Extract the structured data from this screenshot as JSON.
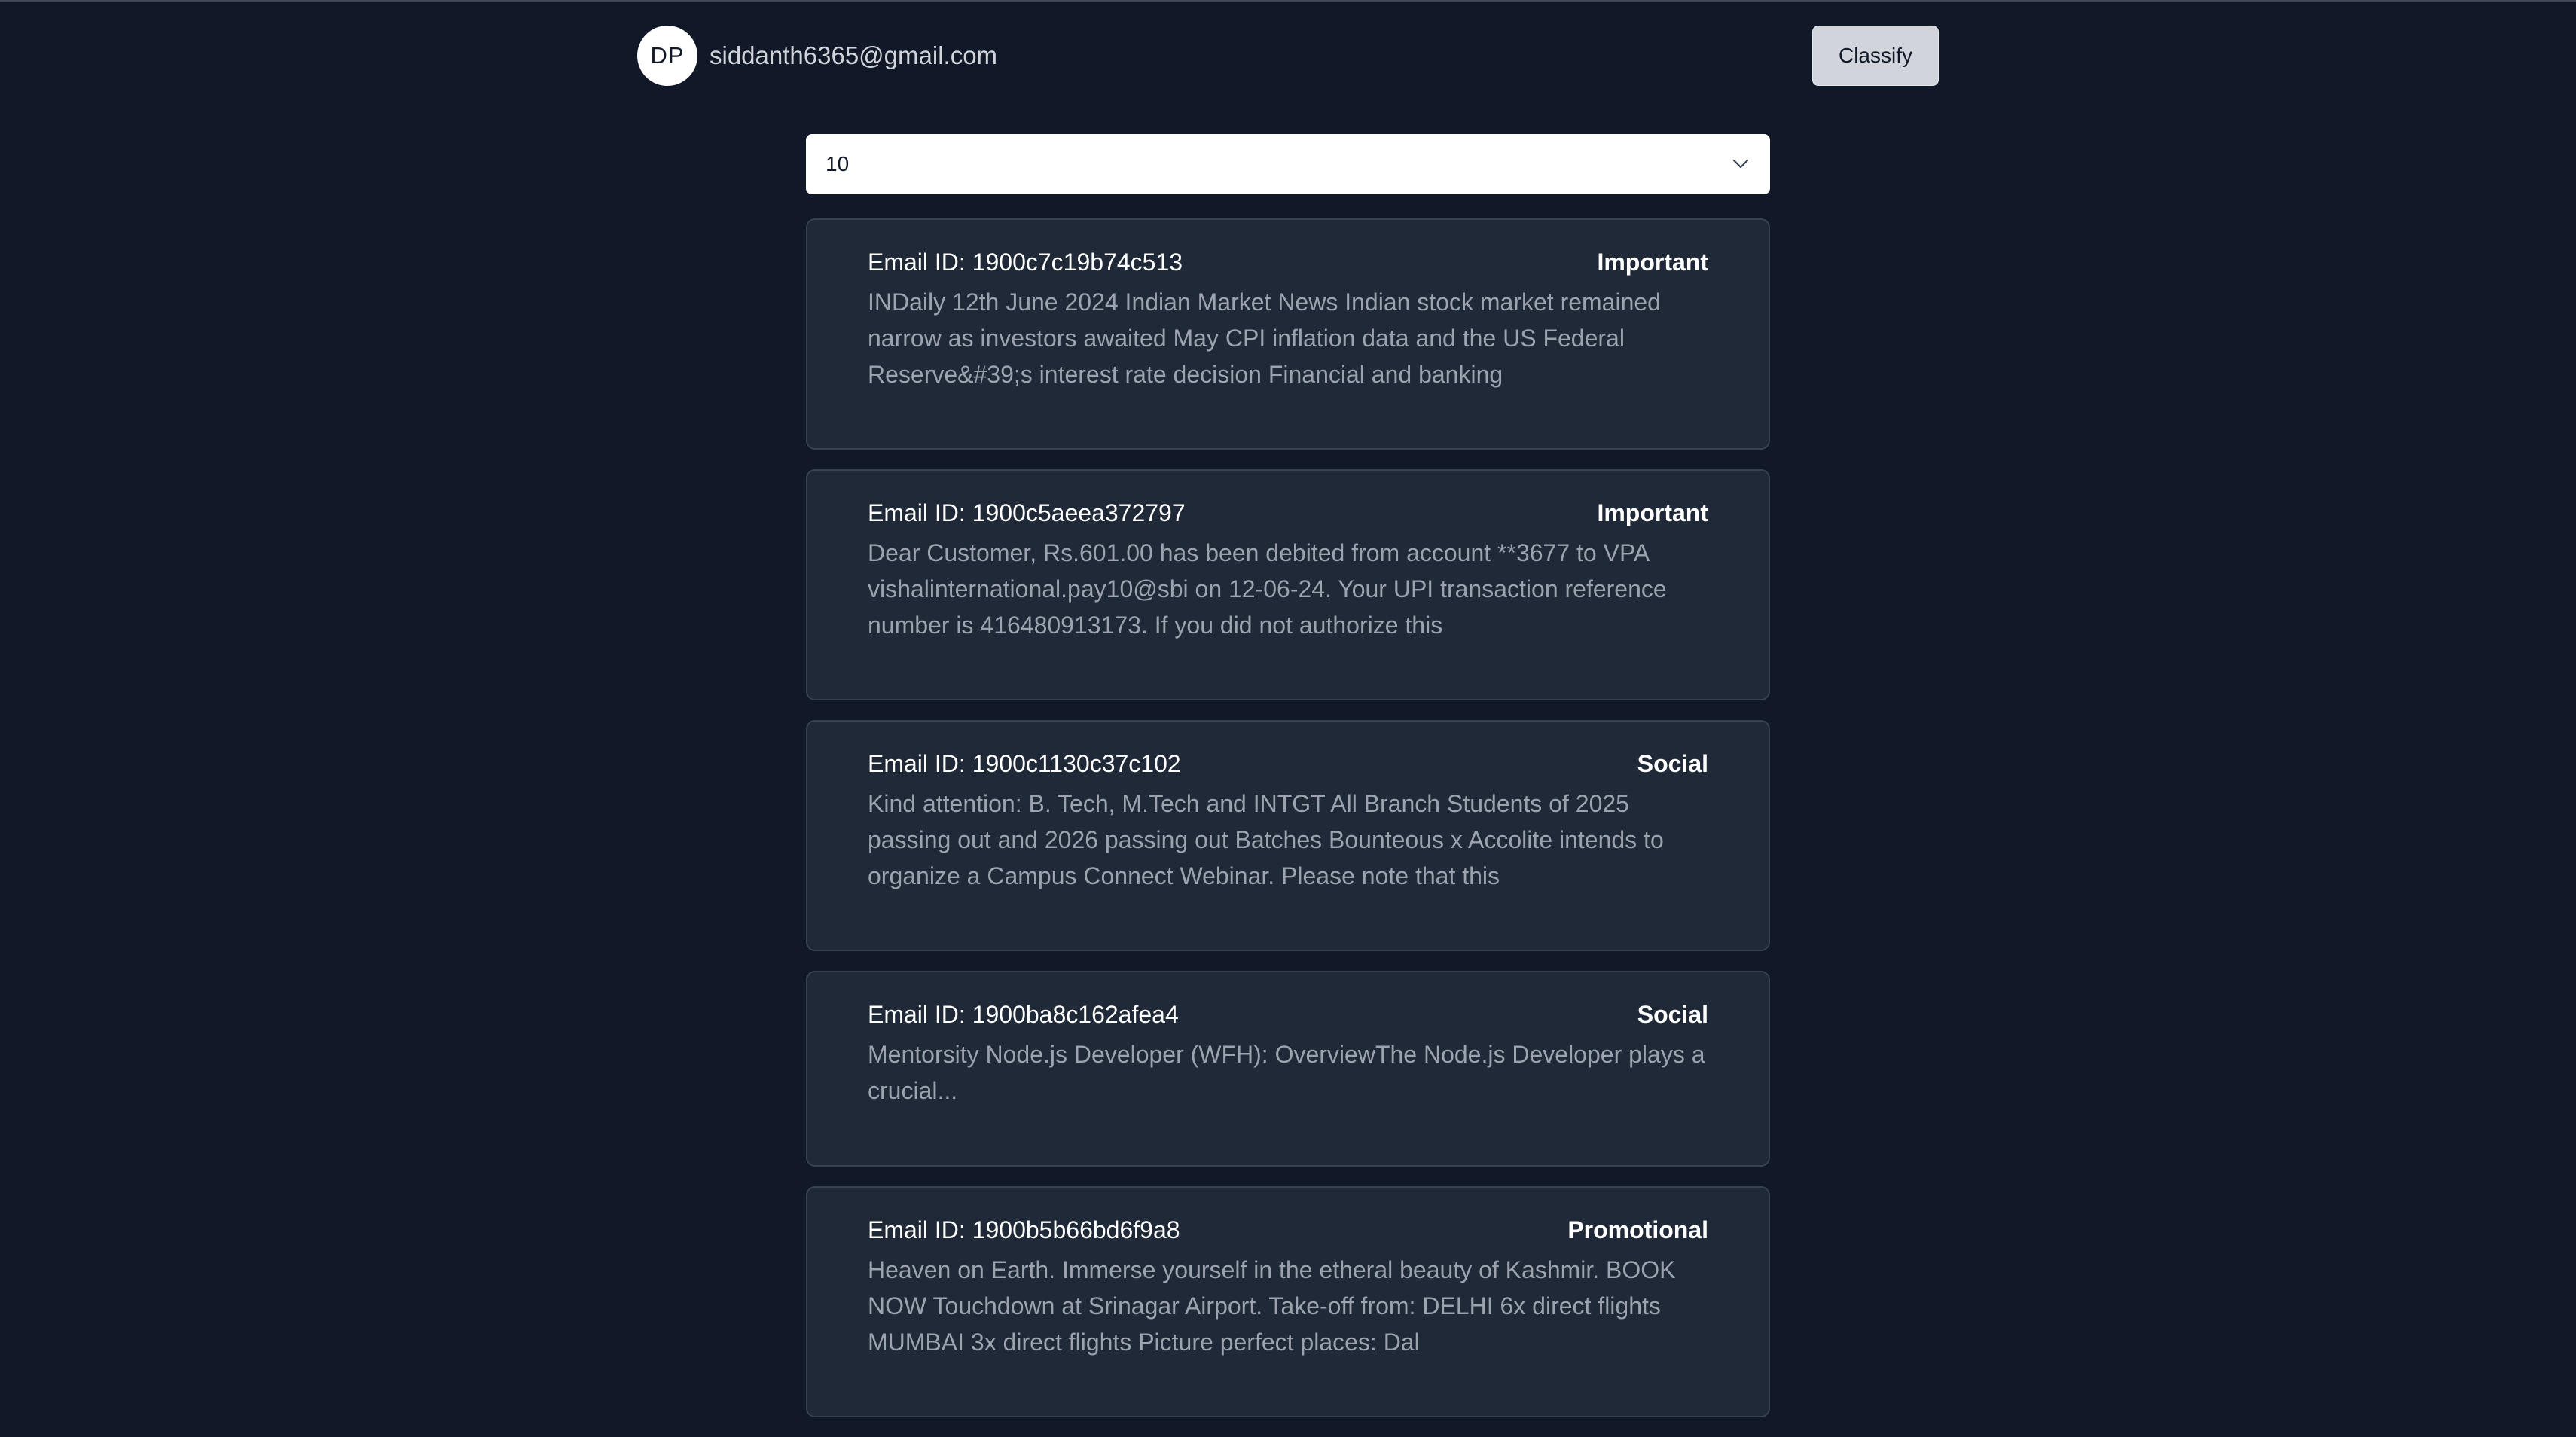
{
  "user": {
    "initials": "DP",
    "email": "siddanth6365@gmail.com"
  },
  "toolbar": {
    "classify_label": "Classify"
  },
  "count_select": {
    "value": "10"
  },
  "emails": [
    {
      "id_text": "Email ID: 1900c7c19b74c513",
      "label": "Important",
      "snippet": "INDaily 12th June 2024 Indian Market News Indian stock market remained narrow as investors awaited May CPI inflation data and the US Federal Reserve&#39;s interest rate decision Financial and banking"
    },
    {
      "id_text": "Email ID: 1900c5aeea372797",
      "label": "Important",
      "snippet": "Dear Customer, Rs.601.00 has been debited from account **3677 to VPA vishalinternational.pay10@sbi on 12-06-24. Your UPI transaction reference number is 416480913173. If you did not authorize this"
    },
    {
      "id_text": "Email ID: 1900c1130c37c102",
      "label": "Social",
      "snippet": "Kind attention: B. Tech, M.Tech and INTGT All Branch Students of 2025 passing out and 2026 passing out Batches Bounteous x Accolite intends to organize a Campus Connect Webinar. Please note that this"
    },
    {
      "id_text": "Email ID: 1900ba8c162afea4",
      "label": "Social",
      "snippet": "Mentorsity Node.js Developer (WFH): OverviewThe Node.js Developer plays a crucial..."
    },
    {
      "id_text": "Email ID: 1900b5b66bd6f9a8",
      "label": "Promotional",
      "snippet": "Heaven on Earth. Immerse yourself in the etheral beauty of Kashmir. BOOK NOW Touchdown at Srinagar Airport. Take-off from: DELHI 6x direct flights MUMBAI 3x direct flights Picture perfect places: Dal"
    }
  ]
}
